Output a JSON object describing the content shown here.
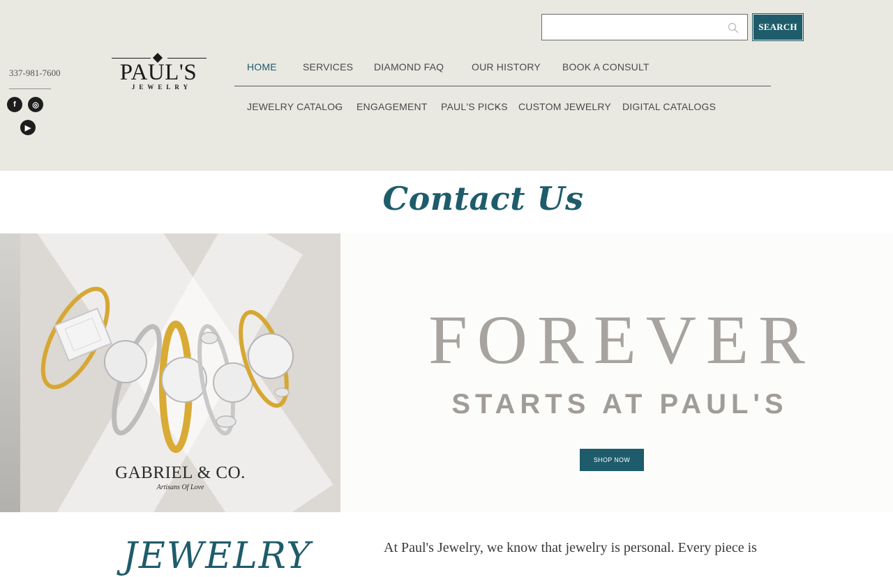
{
  "search": {
    "value": "",
    "placeholder": "",
    "button_label": "SEARCH"
  },
  "contact": {
    "phone": "337-981-7600",
    "rule": "__________",
    "social": [
      {
        "name": "facebook",
        "glyph": "f"
      },
      {
        "name": "instagram",
        "glyph": "◎"
      },
      {
        "name": "youtube",
        "glyph": "▶"
      }
    ]
  },
  "logo": {
    "main": "PAUL'S",
    "sub": "JEWELRY"
  },
  "nav": {
    "primary": [
      {
        "label": "HOME",
        "active": true
      },
      {
        "label": "SERVICES"
      },
      {
        "label": "DIAMOND FAQ"
      },
      {
        "label": "OUR HISTORY"
      },
      {
        "label": "BOOK A CONSULT"
      }
    ],
    "secondary": [
      {
        "label": "JEWELRY CATALOG",
        "dropdown": true
      },
      {
        "label": "ENGAGEMENT"
      },
      {
        "label": "PAUL'S PICKS",
        "dropdown": true
      },
      {
        "label": "CUSTOM JEWELRY"
      },
      {
        "label": "DIGITAL CATALOGS"
      }
    ]
  },
  "page": {
    "title": "Contact Us"
  },
  "banner": {
    "brand": "GABRIEL & CO.",
    "brand_tagline": "Artisans Of Love",
    "headline": "FOREVER",
    "subheadline": "STARTS AT PAUL'S",
    "cta": "SHOP NOW"
  },
  "content": {
    "heading": "JEWELRY",
    "intro": "At Paul's Jewelry, we know that jewelry is personal. Every piece is"
  },
  "colors": {
    "accent": "#1e5c6b",
    "header_bg": "#e9e8e1",
    "headline": "#a7a39e"
  }
}
